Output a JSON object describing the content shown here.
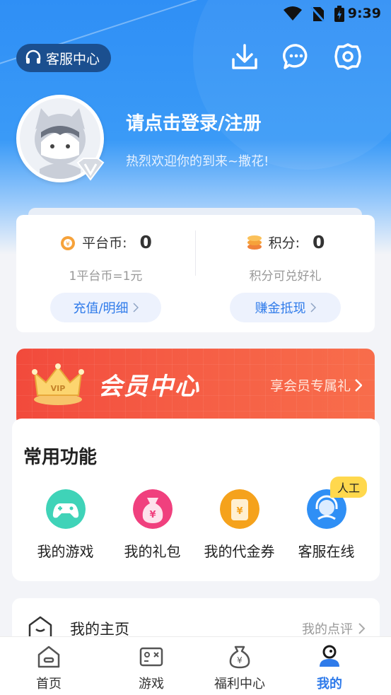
{
  "status": {
    "time": "9:39"
  },
  "header": {
    "customer_service": "客服中心"
  },
  "profile": {
    "login_text": "请点击登录/注册",
    "welcome_text": "热烈欢迎你的到来~撒花!"
  },
  "wallet": {
    "platform_coin_label": "平台币:",
    "platform_coin_value": "0",
    "platform_coin_rate": "1平台币=1元",
    "recharge_button": "充值/明细",
    "points_label": "积分:",
    "points_value": "0",
    "points_note": "积分可兑好礼",
    "redeem_button": "赚金抵现"
  },
  "vip": {
    "title": "会员中心",
    "subtitle": "享会员专属礼"
  },
  "functions": {
    "heading": "常用功能",
    "items": [
      {
        "label": "我的游戏",
        "color": "#3fd3b8"
      },
      {
        "label": "我的礼包",
        "color": "#f0407e"
      },
      {
        "label": "我的代金券",
        "color": "#f5a21c"
      },
      {
        "label": "客服在线",
        "color": "#2f8ff5"
      }
    ],
    "badge": "人工"
  },
  "home_card": {
    "label": "我的主页",
    "right_label": "我的点评"
  },
  "tabbar": {
    "items": [
      {
        "label": "首页"
      },
      {
        "label": "游戏"
      },
      {
        "label": "福利中心"
      },
      {
        "label": "我的"
      }
    ],
    "active_index": 3
  },
  "colors": {
    "accent": "#2f7bea",
    "hero": "#3a9af7",
    "vip": "#f24a3c"
  }
}
